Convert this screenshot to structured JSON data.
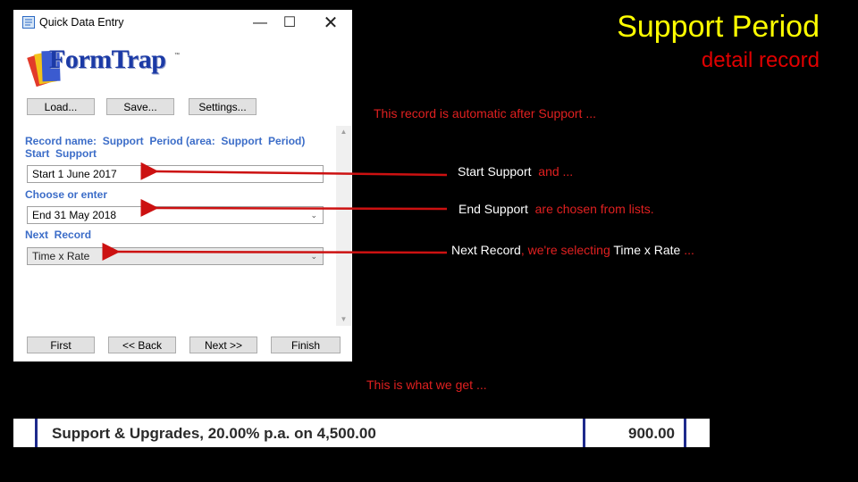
{
  "window": {
    "title": "Quick Data Entry",
    "logo_text": "FormTrap",
    "logo_tm": "™",
    "controls": {
      "minimize": "—",
      "maximize": "☐",
      "close": "✕"
    },
    "toolbar": {
      "load": "Load...",
      "save": "Save...",
      "settings": "Settings..."
    },
    "record_name": "Record name:  Support  Period (area:  Support  Period)",
    "start_support_label": "Start  Support",
    "start_support_value": "Start 1 June 2017",
    "choose_label": "Choose or enter",
    "end_support_value": "End 31 May 2018",
    "next_record_label": "Next  Record",
    "next_record_value": "Time x Rate",
    "nav": {
      "first": "First",
      "back": "<< Back",
      "next": "Next >>",
      "finish": "Finish"
    },
    "scroll_up": "▲",
    "scroll_down": "▼",
    "chevron": "⌄"
  },
  "heading": "Support Period",
  "subheading": "detail record",
  "notes": {
    "auto": "This record is automatic after Support ...",
    "start_a": "Start Support",
    "start_b": "  and ...",
    "end_a": "End Support",
    "end_b": "  are chosen from lists.",
    "next_a": "Next Record",
    "next_b": ", we're selecting ",
    "next_c": "Time x Rate",
    "next_d": " ...",
    "get": "This is what we get ..."
  },
  "invoice_line": {
    "description": "Support & Upgrades, 20.00% p.a. on 4,500.00",
    "amount": "900.00"
  },
  "colors": {
    "heading": "#ffff00",
    "accent_red": "#e00000",
    "label_blue": "#3c6dc8",
    "arrow": "#cc1111",
    "invoice_rule": "#1e2a8c"
  }
}
